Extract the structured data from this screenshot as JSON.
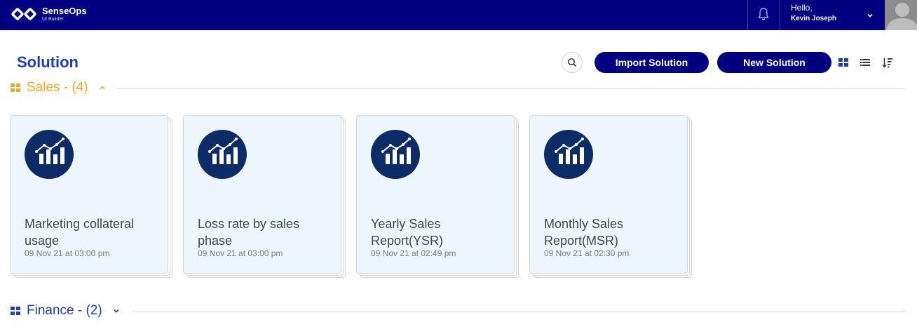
{
  "header": {
    "brand_name": "SenseOps",
    "brand_sub": "UI Builder",
    "greeting": "Hello,",
    "user_name": "Kevin Joseph"
  },
  "page": {
    "title": "Solution",
    "import_label": "Import Solution",
    "new_label": "New Solution"
  },
  "colors": {
    "nav_bg": "#000080",
    "accent_blue": "#1a3fb8",
    "sales_orange": "#f5a623",
    "card_bg": "#eef6fd"
  },
  "sections": [
    {
      "title": "Sales - (4)",
      "expanded": true,
      "cards": [
        {
          "title": "Marketing collateral usage",
          "date": "09 Nov 21 at 03:00 pm",
          "icon": "bar-chart-trend-icon"
        },
        {
          "title": "Loss rate by sales phase",
          "date": "09 Nov 21 at 03:00 pm",
          "icon": "bar-chart-trend-icon"
        },
        {
          "title": "Yearly Sales Report(YSR)",
          "date": "09 Nov 21 at 02:49 pm",
          "icon": "bar-chart-trend-icon"
        },
        {
          "title": "Monthly Sales Report(MSR)",
          "date": "09 Nov 21 at 02:30 pm",
          "icon": "bar-chart-trend-icon"
        }
      ]
    },
    {
      "title": "Finance - (2)",
      "expanded": false,
      "cards": []
    }
  ]
}
